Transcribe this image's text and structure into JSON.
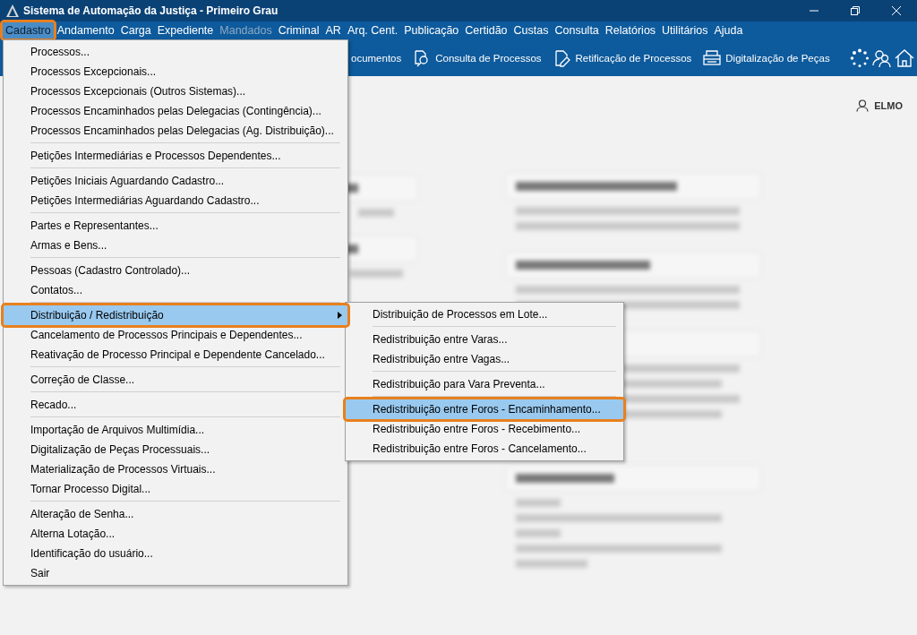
{
  "window": {
    "title": "Sistema de Automação da Justiça - Primeiro Grau"
  },
  "menu_bar": [
    {
      "label": "Cadastro",
      "selected": true,
      "disabled": false
    },
    {
      "label": "Andamento",
      "selected": false,
      "disabled": false
    },
    {
      "label": "Carga",
      "selected": false,
      "disabled": false
    },
    {
      "label": "Expediente",
      "selected": false,
      "disabled": false
    },
    {
      "label": "Mandados",
      "selected": false,
      "disabled": true
    },
    {
      "label": "Criminal",
      "selected": false,
      "disabled": false
    },
    {
      "label": "AR",
      "selected": false,
      "disabled": false
    },
    {
      "label": "Arq. Cent.",
      "selected": false,
      "disabled": false
    },
    {
      "label": "Publicação",
      "selected": false,
      "disabled": false
    },
    {
      "label": "Certidão",
      "selected": false,
      "disabled": false
    },
    {
      "label": "Custas",
      "selected": false,
      "disabled": false
    },
    {
      "label": "Consulta",
      "selected": false,
      "disabled": false
    },
    {
      "label": "Relatórios",
      "selected": false,
      "disabled": false
    },
    {
      "label": "Utilitários",
      "selected": false,
      "disabled": false
    },
    {
      "label": "Ajuda",
      "selected": false,
      "disabled": false
    }
  ],
  "toolbar": [
    {
      "label": "ocumentos",
      "kind": "plain"
    },
    {
      "label": "Consulta de Processos",
      "kind": "consult"
    },
    {
      "label": "Retificação de Processos",
      "kind": "rectify"
    },
    {
      "label": "Digitalização de Peças",
      "kind": "scan"
    }
  ],
  "user": {
    "name": "ELMO"
  },
  "menu": [
    {
      "kind": "item",
      "label": "Processos...",
      "selected": false
    },
    {
      "kind": "item",
      "label": "Processos Excepcionais...",
      "selected": false
    },
    {
      "kind": "item",
      "label": "Processos Excepcionais (Outros Sistemas)...",
      "selected": false
    },
    {
      "kind": "item",
      "label": "Processos Encaminhados pelas Delegacias (Contingência)...",
      "selected": false
    },
    {
      "kind": "item",
      "label": "Processos Encaminhados pelas Delegacias (Ag. Distribuição)...",
      "selected": false
    },
    {
      "kind": "separator"
    },
    {
      "kind": "item",
      "label": "Petições Intermediárias e Processos Dependentes...",
      "selected": false
    },
    {
      "kind": "separator"
    },
    {
      "kind": "item",
      "label": "Petições Iniciais Aguardando Cadastro...",
      "selected": false
    },
    {
      "kind": "item",
      "label": "Petições Intermediárias Aguardando Cadastro...",
      "selected": false
    },
    {
      "kind": "separator"
    },
    {
      "kind": "item",
      "label": "Partes e Representantes...",
      "selected": false
    },
    {
      "kind": "item",
      "label": "Armas e Bens...",
      "selected": false
    },
    {
      "kind": "separator"
    },
    {
      "kind": "item",
      "label": "Pessoas (Cadastro Controlado)...",
      "selected": false
    },
    {
      "kind": "item",
      "label": "Contatos...",
      "selected": false
    },
    {
      "kind": "separator"
    },
    {
      "kind": "submenu",
      "label": "Distribuição / Redistribuição",
      "selected": true
    },
    {
      "kind": "item",
      "label": "Cancelamento de Processos Principais e Dependentes...",
      "selected": false
    },
    {
      "kind": "item",
      "label": "Reativação de Processo Principal e Dependente Cancelado...",
      "selected": false
    },
    {
      "kind": "separator"
    },
    {
      "kind": "item",
      "label": "Correção de Classe...",
      "selected": false
    },
    {
      "kind": "separator"
    },
    {
      "kind": "item",
      "label": "Recado...",
      "selected": false
    },
    {
      "kind": "separator"
    },
    {
      "kind": "item",
      "label": "Importação de Arquivos Multimídia...",
      "selected": false
    },
    {
      "kind": "item",
      "label": "Digitalização de Peças Processuais...",
      "selected": false
    },
    {
      "kind": "item",
      "label": "Materialização de Processos Virtuais...",
      "selected": false
    },
    {
      "kind": "item",
      "label": "Tornar Processo Digital...",
      "selected": false
    },
    {
      "kind": "separator"
    },
    {
      "kind": "item",
      "label": "Alteração de Senha...",
      "selected": false
    },
    {
      "kind": "item",
      "label": "Alterna Lotação...",
      "selected": false
    },
    {
      "kind": "item",
      "label": "Identificação do usuário...",
      "selected": false
    },
    {
      "kind": "item",
      "label": "Sair",
      "selected": false
    }
  ],
  "submenu": [
    {
      "kind": "item",
      "label": "Distribuição de Processos em Lote...",
      "selected": false
    },
    {
      "kind": "separator"
    },
    {
      "kind": "item",
      "label": "Redistribuição entre Varas...",
      "selected": false
    },
    {
      "kind": "item",
      "label": "Redistribuição entre Vagas...",
      "selected": false
    },
    {
      "kind": "separator"
    },
    {
      "kind": "item",
      "label": "Redistribuição para Vara Preventa...",
      "selected": false
    },
    {
      "kind": "separator"
    },
    {
      "kind": "item",
      "label": "Redistribuição entre Foros - Encaminhamento...",
      "selected": true
    },
    {
      "kind": "item",
      "label": "Redistribuição entre Foros - Recebimento...",
      "selected": false
    },
    {
      "kind": "item",
      "label": "Redistribuição entre Foros - Cancelamento...",
      "selected": false
    }
  ]
}
